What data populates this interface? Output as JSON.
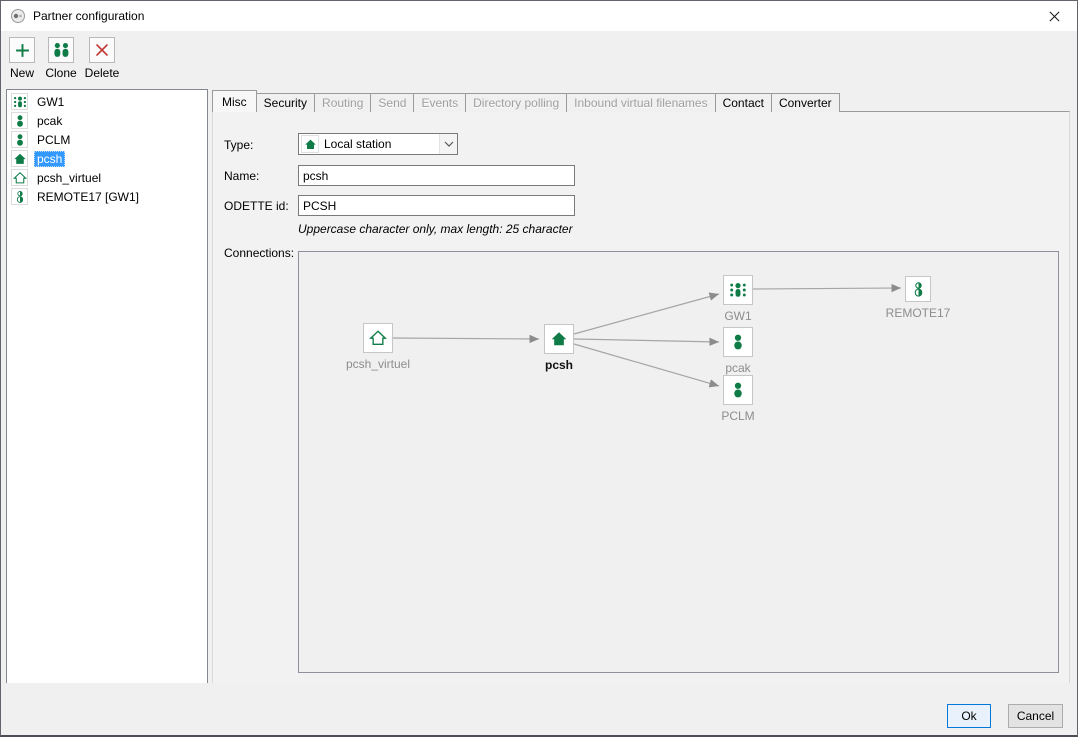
{
  "window": {
    "title": "Partner configuration"
  },
  "toolbar": {
    "new_label": "New",
    "clone_label": "Clone",
    "delete_label": "Delete"
  },
  "sidebar": {
    "items": [
      {
        "label": "GW1",
        "icon": "gateway-icon",
        "selected": false
      },
      {
        "label": "pcak",
        "icon": "partner-icon",
        "selected": false
      },
      {
        "label": "PCLM",
        "icon": "partner-icon",
        "selected": false
      },
      {
        "label": "pcsh",
        "icon": "local-station-icon",
        "selected": true
      },
      {
        "label": "pcsh_virtuel",
        "icon": "virtual-station-icon",
        "selected": false
      },
      {
        "label": "REMOTE17 [GW1]",
        "icon": "remote-partner-icon",
        "selected": false
      }
    ]
  },
  "tabs": [
    {
      "label": "Misc",
      "state": "active"
    },
    {
      "label": "Security",
      "state": "enabled"
    },
    {
      "label": "Routing",
      "state": "disabled"
    },
    {
      "label": "Send",
      "state": "disabled"
    },
    {
      "label": "Events",
      "state": "disabled"
    },
    {
      "label": "Directory polling",
      "state": "disabled"
    },
    {
      "label": "Inbound virtual filenames",
      "state": "disabled"
    },
    {
      "label": "Contact",
      "state": "enabled"
    },
    {
      "label": "Converter",
      "state": "enabled"
    }
  ],
  "form": {
    "type_label": "Type:",
    "type_value": "Local station",
    "name_label": "Name:",
    "name_value": "pcsh",
    "odette_label": "ODETTE id:",
    "odette_value": "PCSH",
    "odette_hint": "Uppercase character only, max length: 25 character",
    "connections_label": "Connections:"
  },
  "diagram": {
    "nodes": [
      {
        "label": "pcsh_virtuel",
        "icon": "virtual-station-icon",
        "emphasis": false
      },
      {
        "label": "pcsh",
        "icon": "local-station-icon",
        "emphasis": true
      },
      {
        "label": "GW1",
        "icon": "gateway-icon",
        "emphasis": false
      },
      {
        "label": "pcak",
        "icon": "partner-icon",
        "emphasis": false
      },
      {
        "label": "PCLM",
        "icon": "partner-icon",
        "emphasis": false
      },
      {
        "label": "REMOTE17",
        "icon": "remote-partner-icon",
        "emphasis": false
      }
    ],
    "edges": [
      {
        "from": "pcsh_virtuel",
        "to": "pcsh"
      },
      {
        "from": "pcsh",
        "to": "GW1"
      },
      {
        "from": "pcsh",
        "to": "pcak"
      },
      {
        "from": "pcsh",
        "to": "PCLM"
      },
      {
        "from": "GW1",
        "to": "REMOTE17"
      }
    ]
  },
  "footer": {
    "ok_label": "Ok",
    "cancel_label": "Cancel"
  },
  "colors": {
    "brand_green": "#0f7c48",
    "delete_red": "#c23b3b",
    "selection_blue": "#3399ff",
    "focus_blue": "#0078d7"
  }
}
